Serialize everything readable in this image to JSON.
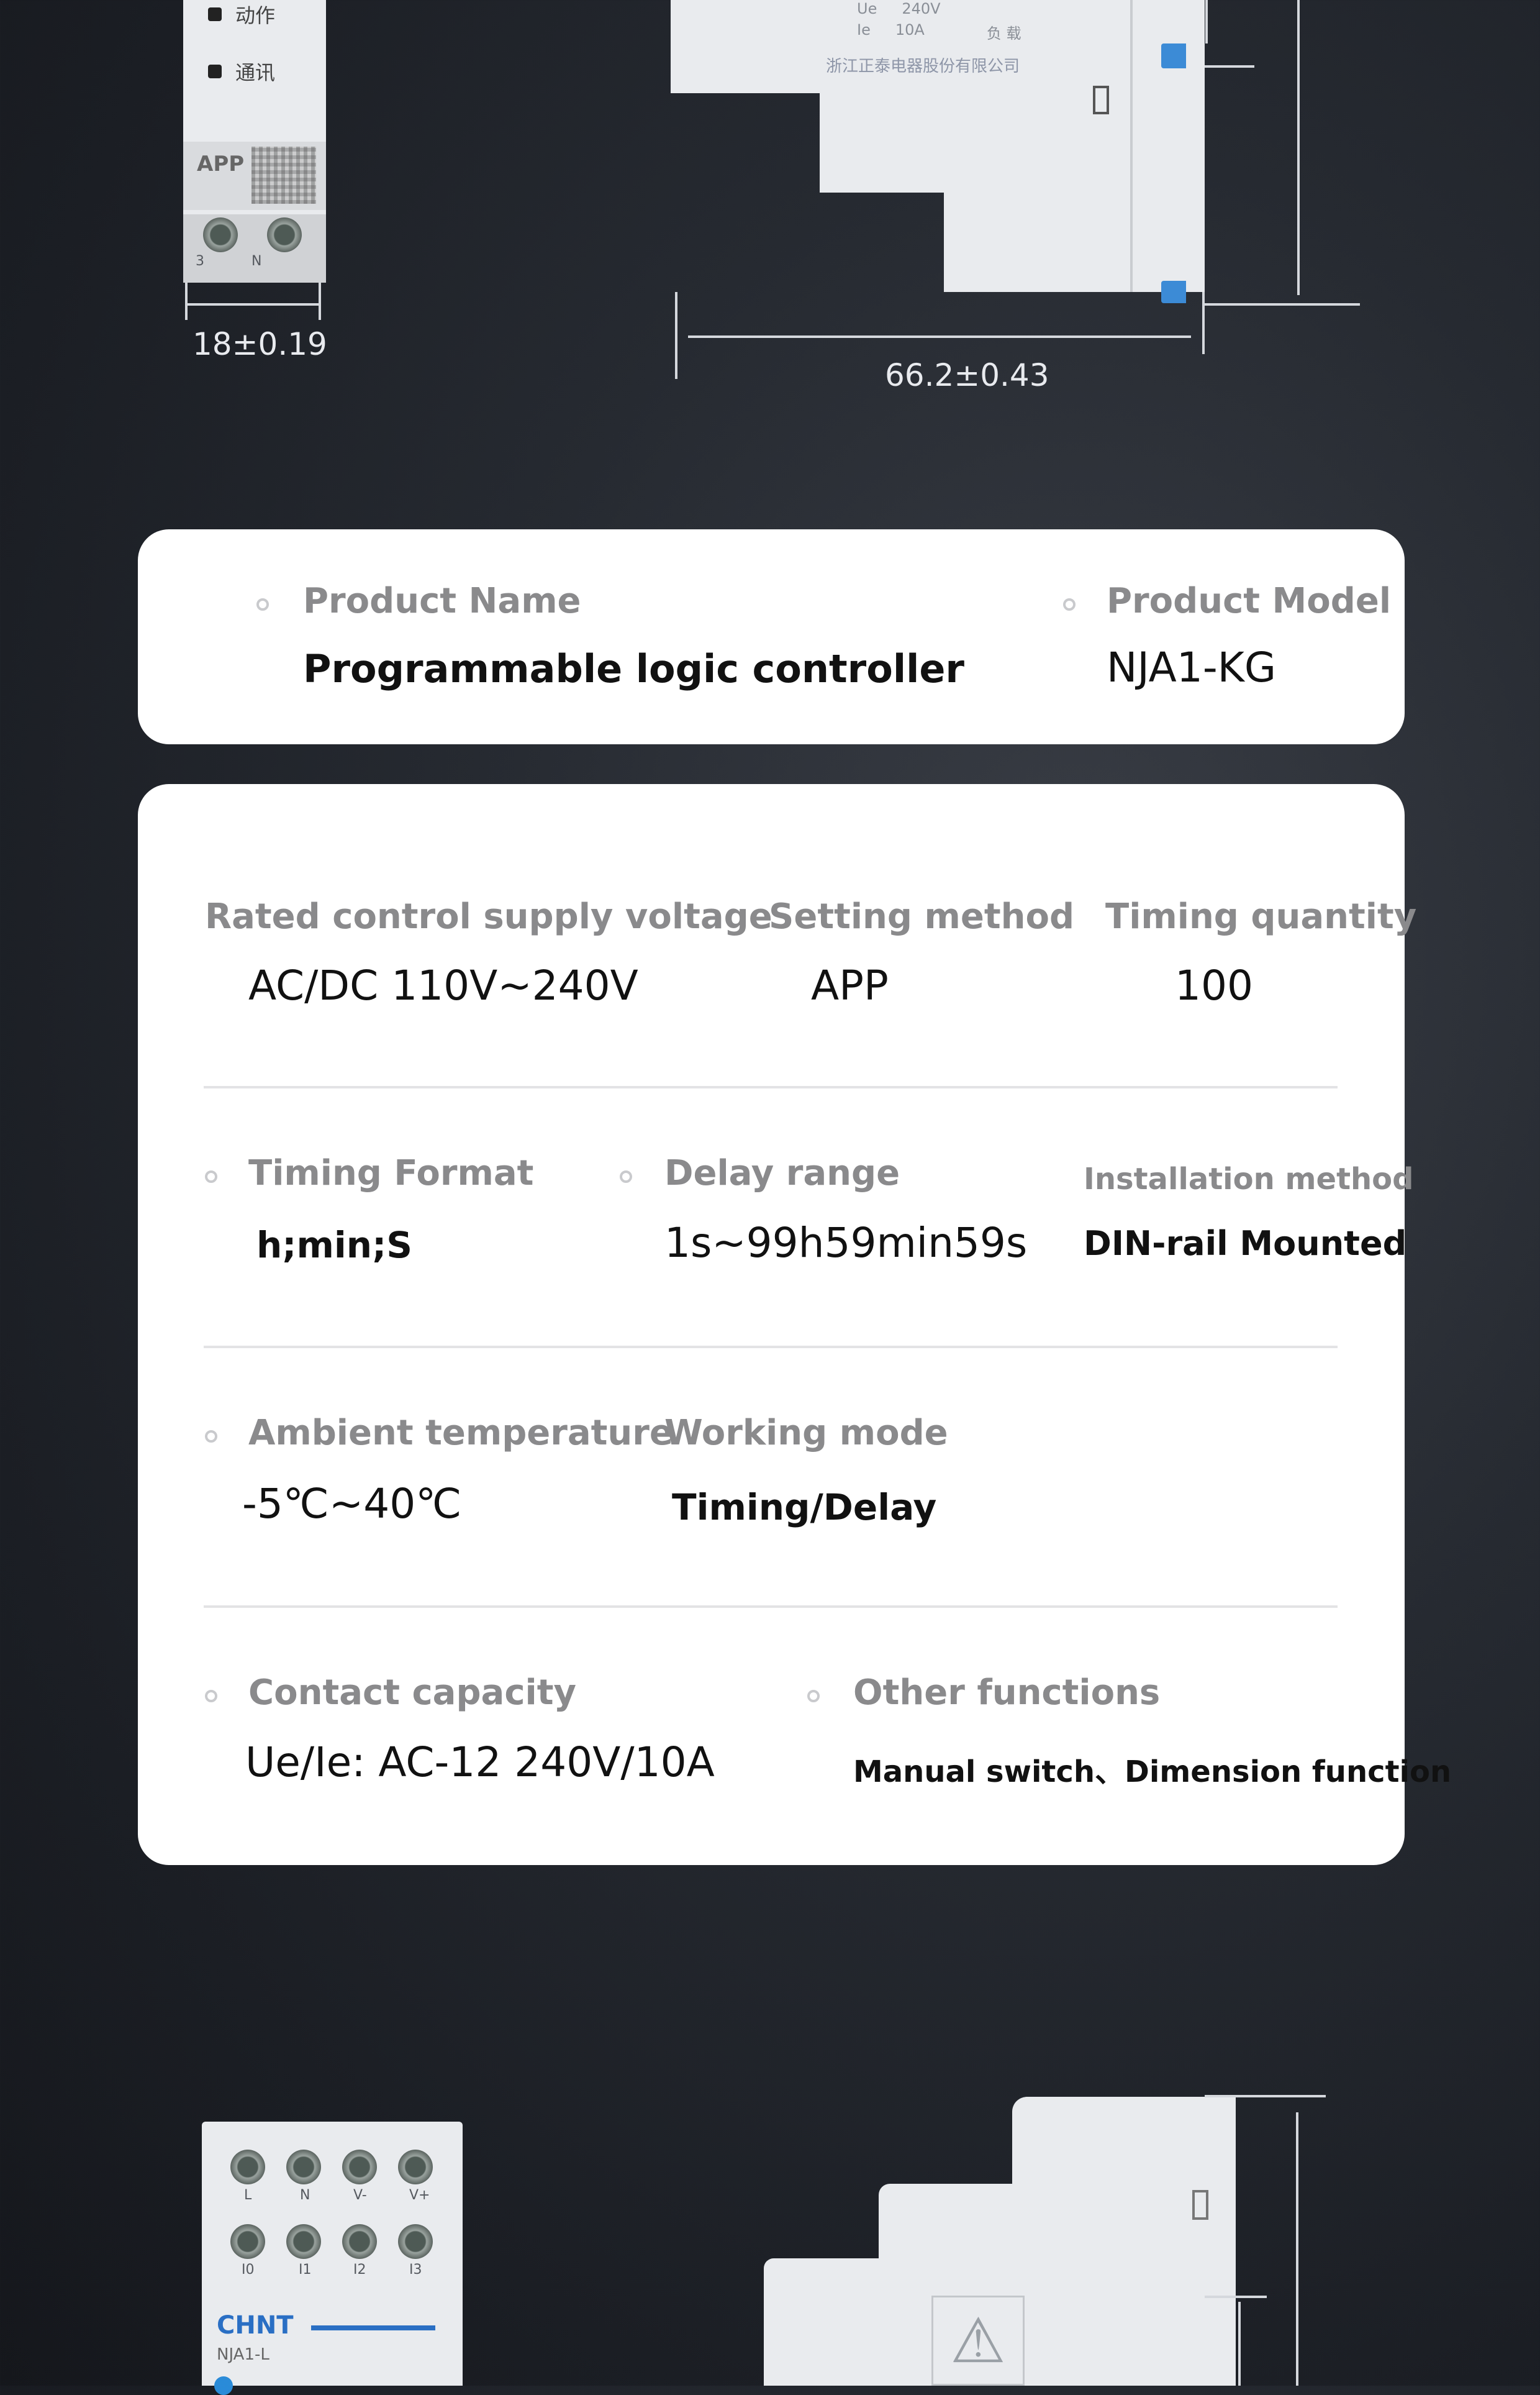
{
  "top_device": {
    "indicators": [
      "动作",
      "通讯"
    ],
    "app_label": "APP",
    "terminals": [
      "3",
      "N"
    ],
    "width_dim": "18±0.19"
  },
  "side_device": {
    "spec_rows": [
      [
        "Ue",
        "240V"
      ],
      [
        "Ie",
        "10A"
      ]
    ],
    "load_label": "负 载",
    "maker": "浙江正泰电器股份有限公司",
    "depth_dim": "66.2±0.43"
  },
  "product_card": {
    "name_label": "Product Name",
    "name_value": "Programmable logic controller",
    "model_label": "Product Model",
    "model_value": "NJA1-KG"
  },
  "specs": {
    "supply_voltage": {
      "label": "Rated control supply voltage",
      "value": "AC/DC 110V~240V"
    },
    "setting_method": {
      "label": "Setting method",
      "value": "APP"
    },
    "timing_quantity": {
      "label": "Timing quantity",
      "value": "100"
    },
    "timing_format": {
      "label": "Timing Format",
      "value": "h;min;S"
    },
    "delay_range": {
      "label": "Delay range",
      "value": "1s~99h59min59s"
    },
    "installation": {
      "label": "Installation method",
      "value": "DIN-rail Mounted"
    },
    "ambient_temp": {
      "label": "Ambient temperature",
      "value": "-5℃~40℃"
    },
    "working_mode": {
      "label": "Working mode",
      "value": "Timing/Delay"
    },
    "contact_capacity": {
      "label": "Contact capacity",
      "value": "Ue/Ie:  AC-12 240V/10A"
    },
    "other_functions": {
      "label": "Other functions",
      "value": "Manual switch、Dimension function"
    }
  },
  "bottom_device": {
    "terminals_top": [
      "L",
      "N",
      "V-",
      "V+"
    ],
    "terminals_bottom": [
      "I0",
      "I1",
      "I2",
      "I3"
    ],
    "brand": "CHNT",
    "model": "NJA1-L"
  }
}
